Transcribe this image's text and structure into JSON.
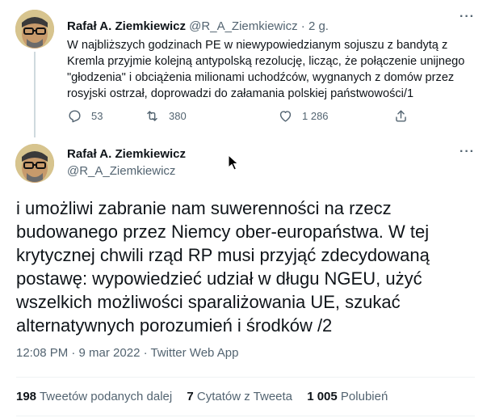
{
  "tweet1": {
    "author_name": "Rafał A. Ziemkiewicz",
    "author_handle": "@R_A_Ziemkiewicz",
    "separator": " · ",
    "time_ago": "2 g.",
    "more_label": "···",
    "text": "W najbliższych godzinach PE w niewypowiedzianym sojuszu z bandytą z Kremla przyjmie kolejną antypolską rezolucję, licząc, że połączenie unijnego \"głodzenia\" i obciążenia milionami uchodźców, wygnanych z domów przez rosyjski ostrzał, doprowadzi do załamania polskiej państwowości/1",
    "replies": "53",
    "retweets": "380",
    "likes": "1 286",
    "icons": {
      "reply": "reply-icon",
      "retweet": "retweet-icon",
      "like": "heart-icon",
      "share": "share-icon"
    }
  },
  "tweet2": {
    "author_name": "Rafał A. Ziemkiewicz",
    "author_handle": "@R_A_Ziemkiewicz",
    "more_label": "···",
    "text": "i umożliwi zabranie nam suwerenności na rzecz budowanego przez Niemcy ober-europaństwa. W tej krytycznej chwili rząd RP musi przyjąć zdecydowaną postawę: wypowiedzieć udział w długu NGEU, użyć wszelkich możliwości sparaliżowania UE, szukać alternatywnych porozumień i środków /2",
    "meta": "12:08 PM · 9 mar 2022 · Twitter Web App",
    "stats": {
      "retweets_count": "198",
      "retweets_label": "Tweetów podanych dalej",
      "quotes_count": "7",
      "quotes_label": "Cytatów z Tweeta",
      "likes_count": "1 005",
      "likes_label": "Polubień"
    }
  },
  "colors": {
    "text_primary": "#0f1419",
    "text_secondary": "#536471",
    "divider": "#eff3f4",
    "thread_line": "#cfd9de"
  }
}
